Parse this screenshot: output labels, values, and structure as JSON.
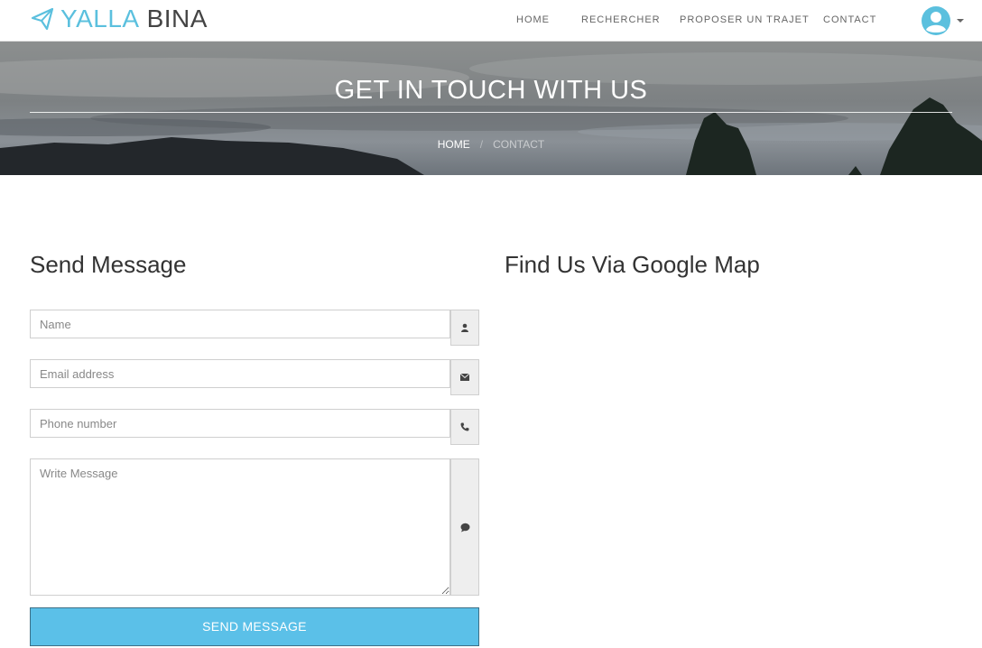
{
  "brand": {
    "word1": "YALLA",
    "word2": "BINA",
    "icon": "paper-plane-icon",
    "color": "#5bc0de"
  },
  "nav": {
    "items": [
      {
        "label": "HOME"
      },
      {
        "label": "RECHERCHER"
      },
      {
        "label": "PROPOSER UN TRAJET"
      },
      {
        "label": "CONTACT"
      }
    ],
    "avatar_icon": "user-circle-icon",
    "avatar_color": "#5bc0de"
  },
  "hero": {
    "title": "GET IN TOUCH WITH US",
    "breadcrumb": {
      "home": "HOME",
      "separator": "/",
      "current": "CONTACT"
    }
  },
  "contact_form": {
    "heading": "Send Message",
    "name_placeholder": "Name",
    "email_placeholder": "Email address",
    "phone_placeholder": "Phone number",
    "message_placeholder": "Write Message",
    "submit_label": "SEND MESSAGE",
    "submit_color": "#5bc0e8",
    "icons": [
      "user-icon",
      "envelope-icon",
      "phone-icon",
      "comment-icon"
    ]
  },
  "map_section": {
    "heading": "Find Us Via Google Map"
  }
}
